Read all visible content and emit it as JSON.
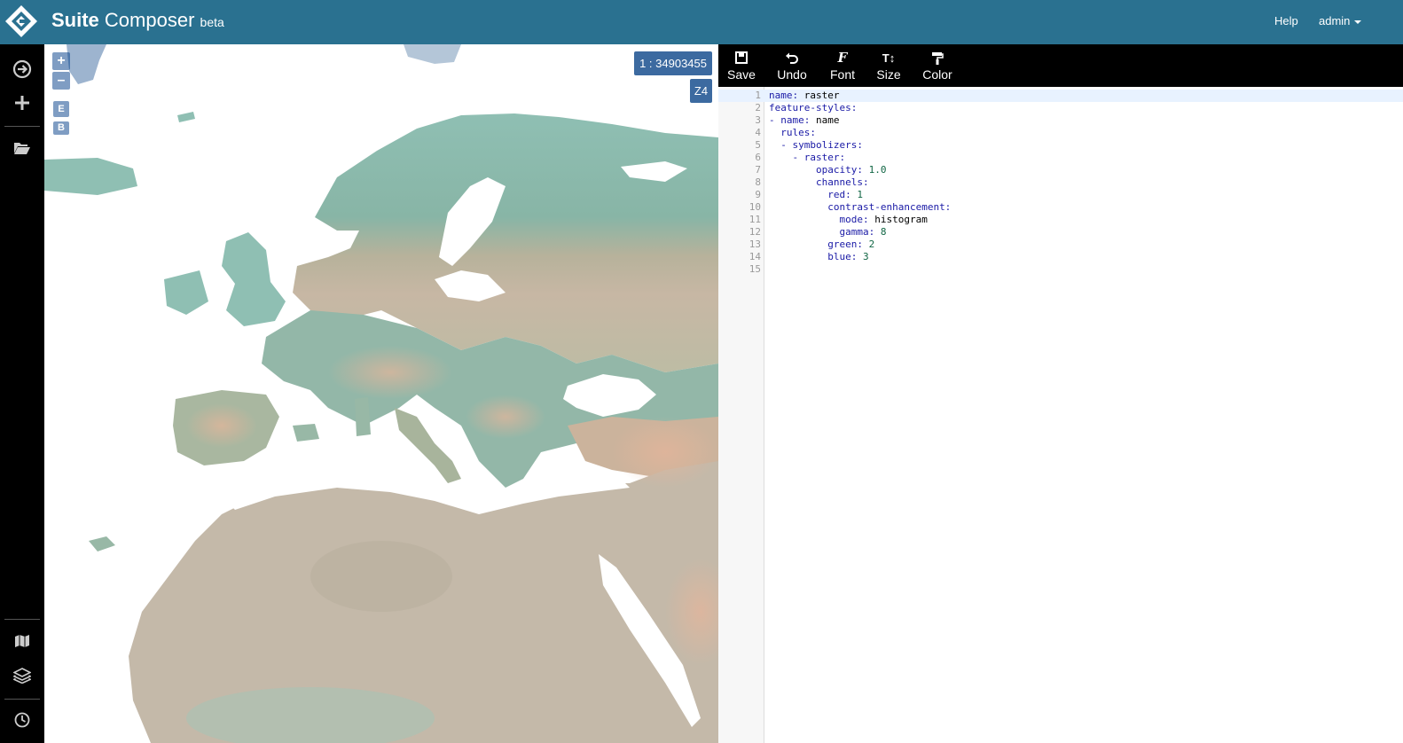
{
  "navbar": {
    "brand_bold": "Suite",
    "brand_rest": "Composer",
    "brand_tag": "beta",
    "help": "Help",
    "user": "admin"
  },
  "sidebar": {
    "icons": [
      "arrow-right-circle-icon",
      "plus-icon",
      "folder-open-icon",
      "map-icon",
      "layers-icon",
      "clock-icon"
    ]
  },
  "map": {
    "zoom_in": "+",
    "zoom_out": "–",
    "btn_e": "E",
    "btn_b": "B",
    "scale": "1 : 34903455",
    "zoom_level": "Z4"
  },
  "toolbar": {
    "save": "Save",
    "undo": "Undo",
    "font": "Font",
    "size": "Size",
    "color": "Color"
  },
  "editor": {
    "lines": [
      {
        "n": "1",
        "indent": "",
        "key": "name",
        "val": "raster",
        "num": ""
      },
      {
        "n": "2",
        "indent": "",
        "key": "feature-styles",
        "val": "",
        "num": ""
      },
      {
        "n": "3",
        "indent": "- ",
        "key": "name",
        "val": "name",
        "num": ""
      },
      {
        "n": "4",
        "indent": "  ",
        "key": "rules",
        "val": "",
        "num": ""
      },
      {
        "n": "5",
        "indent": "  - ",
        "key": "symbolizers",
        "val": "",
        "num": ""
      },
      {
        "n": "6",
        "indent": "    - ",
        "key": "raster",
        "val": "",
        "num": ""
      },
      {
        "n": "7",
        "indent": "        ",
        "key": "opacity",
        "val": "",
        "num": "1.0"
      },
      {
        "n": "8",
        "indent": "        ",
        "key": "channels",
        "val": "",
        "num": ""
      },
      {
        "n": "9",
        "indent": "          ",
        "key": "red",
        "val": "",
        "num": "1"
      },
      {
        "n": "10",
        "indent": "          ",
        "key": "contrast-enhancement",
        "val": "",
        "num": ""
      },
      {
        "n": "11",
        "indent": "            ",
        "key": "mode",
        "val": "histogram",
        "num": ""
      },
      {
        "n": "12",
        "indent": "            ",
        "key": "gamma",
        "val": "",
        "num": "8"
      },
      {
        "n": "13",
        "indent": "          ",
        "key": "green",
        "val": "",
        "num": "2"
      },
      {
        "n": "14",
        "indent": "          ",
        "key": "blue",
        "val": "",
        "num": "3"
      },
      {
        "n": "15",
        "indent": "",
        "key": "",
        "val": "",
        "num": ""
      }
    ]
  }
}
